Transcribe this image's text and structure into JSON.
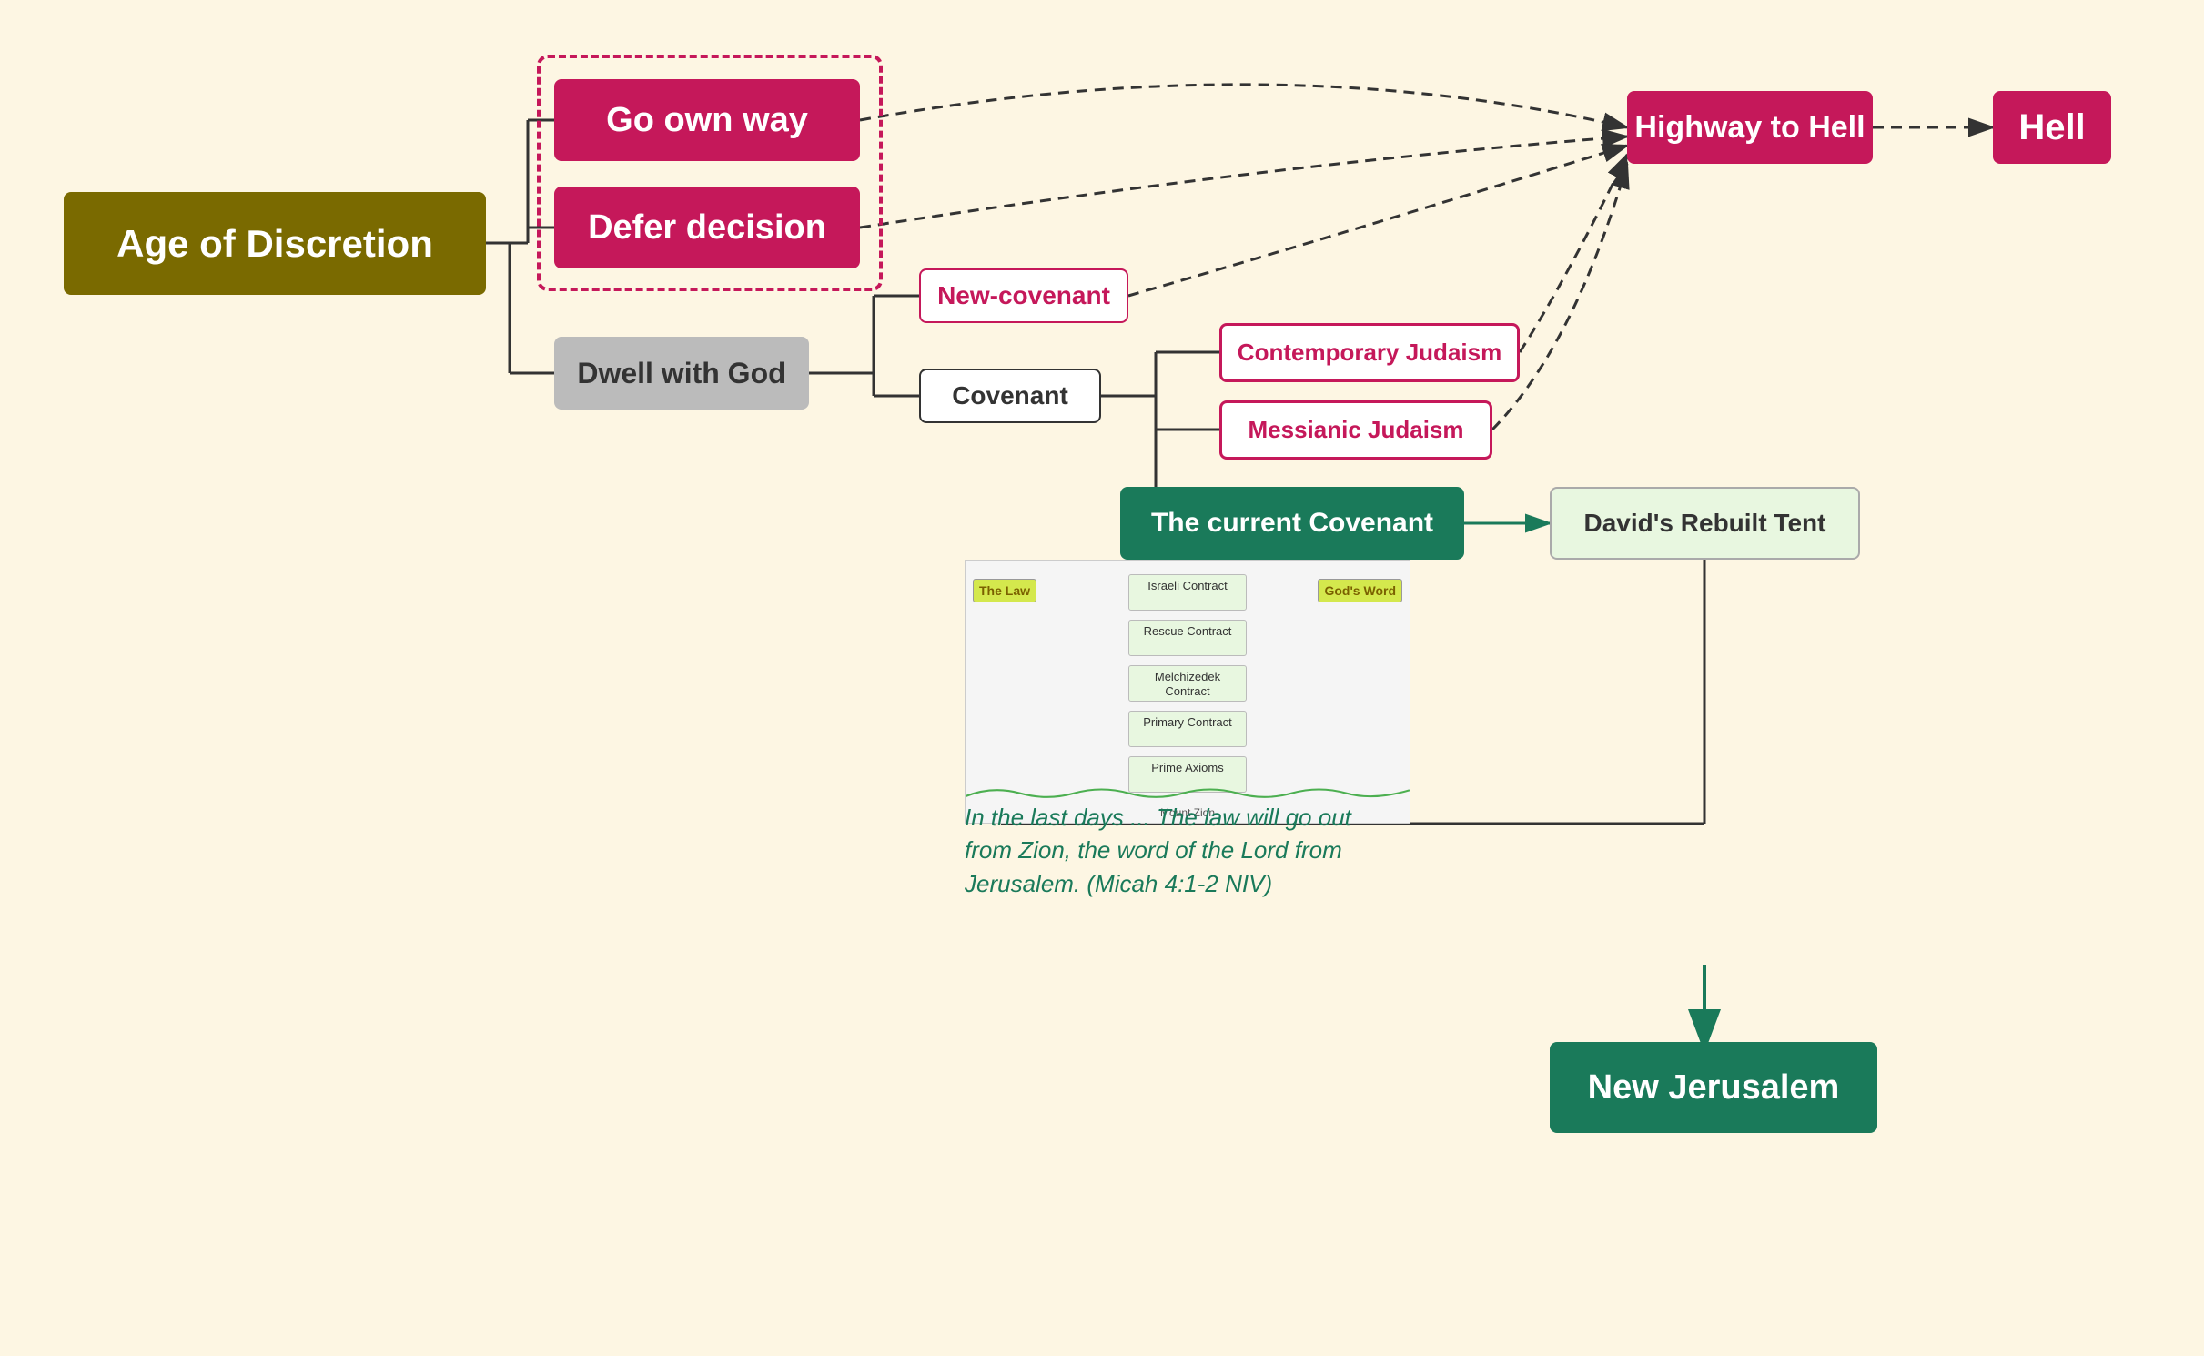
{
  "nodes": {
    "age_of_discretion": "Age of Discretion",
    "go_own_way": "Go own way",
    "defer_decision": "Defer decision",
    "dwell_with_god": "Dwell with God",
    "new_covenant": "New-covenant",
    "covenant": "Covenant",
    "contemporary_judaism": "Contemporary Judaism",
    "messianic_judaism": "Messianic Judaism",
    "current_covenant": "The current Covenant",
    "highway_to_hell": "Highway to Hell",
    "hell": "Hell",
    "davids_rebuilt_tent": "David's Rebuilt Tent",
    "new_jerusalem": "New Jerusalem",
    "quote": "In the last days ... The law will go out from Zion, the word of the Lord from Jerusalem. (Micah 4:1-2 NIV)"
  },
  "mz": {
    "the_law": "The Law",
    "gods_word": "God's Word",
    "israel_contract": "Israeli Contract",
    "rescue_contract": "Rescue Contract",
    "melchizedek_contract": "Melchizedek Contract",
    "primary_contract": "Primary Contract",
    "prime_axioms": "Prime Axioms",
    "mount_zion": "Mount Zion"
  },
  "colors": {
    "bg": "#fdf6e3",
    "dark_olive": "#7a6a00",
    "crimson": "#c5185a",
    "dark_green": "#1a7a5a",
    "gray": "#bbb",
    "light_green_bg": "#e8f7e0",
    "yellow_green": "#d4e84d"
  }
}
